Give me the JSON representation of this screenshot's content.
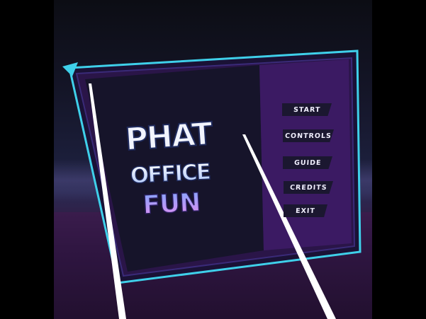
{
  "game": {
    "logo": {
      "line1": "PHAT",
      "line2": "OFFICE",
      "line3": "FUN"
    },
    "menu": {
      "items": [
        {
          "label": "START"
        },
        {
          "label": "CONTROLS"
        },
        {
          "label": "GUIDE"
        },
        {
          "label": "CREDITS"
        },
        {
          "label": "EXIT"
        }
      ]
    }
  },
  "colors": {
    "frame_cyan": "#3fd0ea",
    "panel_purple": "#3b1a63",
    "button_bg": "#1b1730",
    "logo_white": "#f2f4ff",
    "logo_blue": "#7fa7ff",
    "logo_pink": "#e58cf0"
  }
}
